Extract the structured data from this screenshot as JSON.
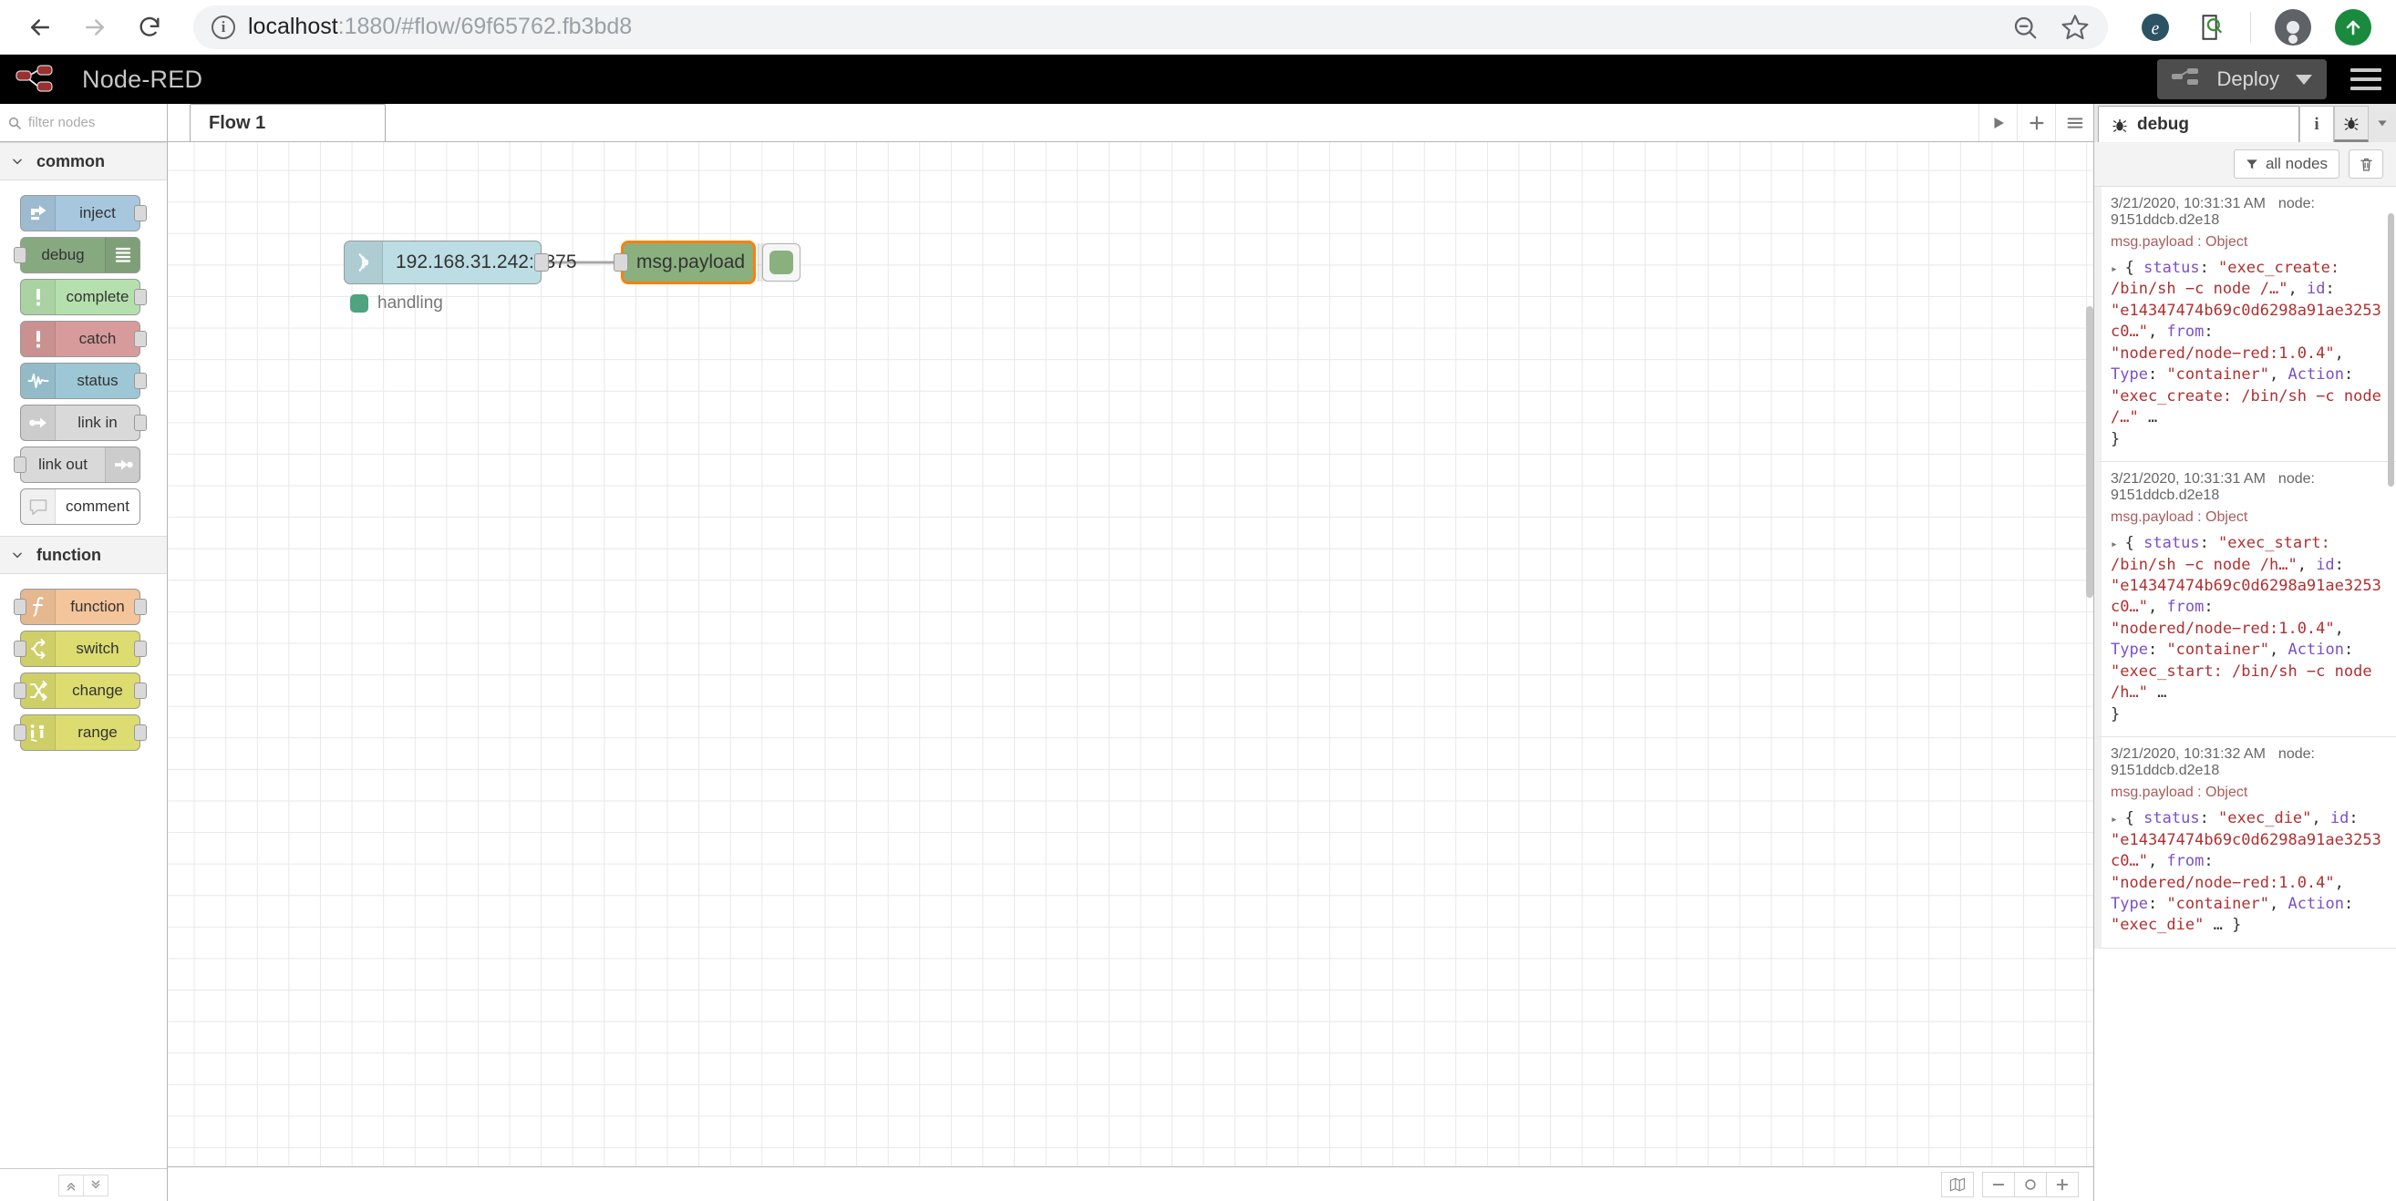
{
  "browser": {
    "back_icon": "back-arrow-icon",
    "forward_icon": "forward-arrow-icon",
    "reload_icon": "reload-icon",
    "info_glyph": "i",
    "url_host": "localhost",
    "url_rest": ":1880/#flow/69f65762.fb3bd8",
    "zoom_out_icon": "zoom-out-icon",
    "bookmark_icon": "star-icon",
    "ext_icons": [
      "extension-e-icon",
      "extension-inspect-icon"
    ],
    "profile_icon": "profile-avatar-icon",
    "update_icon": "update-arrow-icon"
  },
  "header": {
    "title": "Node-RED",
    "deploy_label": "Deploy",
    "menu_icon": "hamburger-menu-icon"
  },
  "palette": {
    "search_placeholder": "filter nodes",
    "categories": [
      {
        "name": "common",
        "nodes": [
          {
            "label": "inject",
            "icon": "inject-arrow-icon",
            "bg": "#a7c7de",
            "icon_side": "left",
            "port_in": false,
            "port_out": true
          },
          {
            "label": "debug",
            "icon": "debug-list-icon",
            "bg": "#87a980",
            "icon_side": "right",
            "port_in": true,
            "port_out": false
          },
          {
            "label": "complete",
            "icon": "exclamation-icon",
            "bg": "#b5e0ad",
            "icon_side": "left",
            "port_in": false,
            "port_out": true
          },
          {
            "label": "catch",
            "icon": "exclamation-icon",
            "bg": "#d79b9b",
            "icon_side": "left",
            "port_in": false,
            "port_out": true
          },
          {
            "label": "status",
            "icon": "waveform-icon",
            "bg": "#9dc7d4",
            "icon_side": "left",
            "port_in": false,
            "port_out": true
          },
          {
            "label": "link in",
            "icon": "link-in-icon",
            "bg": "#d9d9d9",
            "icon_side": "left",
            "port_in": false,
            "port_out": true
          },
          {
            "label": "link out",
            "icon": "link-out-icon",
            "bg": "#d9d9d9",
            "icon_side": "right",
            "port_in": true,
            "port_out": false
          },
          {
            "label": "comment",
            "icon": "comment-bubble-icon",
            "bg": "#ffffff",
            "icon_side": "left",
            "port_in": false,
            "port_out": false
          }
        ]
      },
      {
        "name": "function",
        "nodes": [
          {
            "label": "function",
            "icon": "function-f-icon",
            "bg": "#f4c49a",
            "icon_side": "left",
            "port_in": true,
            "port_out": true
          },
          {
            "label": "switch",
            "icon": "switch-branch-icon",
            "bg": "#dcdc70",
            "icon_side": "left",
            "port_in": true,
            "port_out": true
          },
          {
            "label": "change",
            "icon": "change-swap-icon",
            "bg": "#dcdc70",
            "icon_side": "left",
            "port_in": true,
            "port_out": true
          },
          {
            "label": "range",
            "icon": "range-bars-icon",
            "bg": "#dcdc70",
            "icon_side": "left",
            "port_in": true,
            "port_out": true
          }
        ]
      }
    ],
    "footer_buttons": [
      "collapse-all-icon",
      "expand-all-icon"
    ]
  },
  "flow": {
    "tab_label": "Flow 1",
    "toolbar_buttons": [
      "play-icon",
      "add-tab-icon",
      "list-tabs-icon"
    ],
    "nodes": [
      {
        "label": "192.168.31.242:2375",
        "icon": "docker-events-signal-icon",
        "bg": "#bcdde4",
        "status": "handling",
        "status_color": "#4ea47e"
      },
      {
        "label": "msg.payload",
        "icon": "debug-list-icon",
        "bg": "#8ab07e",
        "selected": true
      }
    ],
    "statusbar_buttons": [
      "map-icon",
      "zoom-out-icon",
      "zoom-reset-icon",
      "zoom-in-icon"
    ]
  },
  "sidebar": {
    "tab_label": "debug",
    "tab_icon": "bug-icon",
    "header_buttons": [
      "info-icon",
      "bug-icon",
      "chevron-down-icon"
    ],
    "filter_label": "all nodes",
    "filter_icon": "funnel-icon",
    "clear_icon": "trash-icon",
    "messages": [
      {
        "timestamp": "3/21/2020, 10:31:31 AM",
        "node": "node: 9151ddcb.d2e18",
        "topic": "msg.payload : Object",
        "parts": [
          {
            "t": "p",
            "v": "{ "
          },
          {
            "t": "k",
            "v": "status"
          },
          {
            "t": "p",
            "v": ": "
          },
          {
            "t": "s",
            "v": "\"exec_create: /bin/sh −c node /…\""
          },
          {
            "t": "p",
            "v": ", "
          },
          {
            "t": "k",
            "v": "id"
          },
          {
            "t": "p",
            "v": ": "
          },
          {
            "t": "s",
            "v": "\"e14347474b69c0d6298a91ae3253c0…\""
          },
          {
            "t": "p",
            "v": ", "
          },
          {
            "t": "k",
            "v": "from"
          },
          {
            "t": "p",
            "v": ": "
          },
          {
            "t": "s",
            "v": "\"nodered/node−red:1.0.4\""
          },
          {
            "t": "p",
            "v": ", "
          },
          {
            "t": "k",
            "v": "Type"
          },
          {
            "t": "p",
            "v": ": "
          },
          {
            "t": "s",
            "v": "\"container\""
          },
          {
            "t": "p",
            "v": ", "
          },
          {
            "t": "k",
            "v": "Action"
          },
          {
            "t": "p",
            "v": ": "
          },
          {
            "t": "s",
            "v": "\"exec_create: /bin/sh −c node /…\""
          },
          {
            "t": "p",
            "v": " … }"
          }
        ]
      },
      {
        "timestamp": "3/21/2020, 10:31:31 AM",
        "node": "node: 9151ddcb.d2e18",
        "topic": "msg.payload : Object",
        "parts": [
          {
            "t": "p",
            "v": "{ "
          },
          {
            "t": "k",
            "v": "status"
          },
          {
            "t": "p",
            "v": ": "
          },
          {
            "t": "s",
            "v": "\"exec_start: /bin/sh −c node /h…\""
          },
          {
            "t": "p",
            "v": ", "
          },
          {
            "t": "k",
            "v": "id"
          },
          {
            "t": "p",
            "v": ": "
          },
          {
            "t": "s",
            "v": "\"e14347474b69c0d6298a91ae3253c0…\""
          },
          {
            "t": "p",
            "v": ", "
          },
          {
            "t": "k",
            "v": "from"
          },
          {
            "t": "p",
            "v": ": "
          },
          {
            "t": "s",
            "v": "\"nodered/node−red:1.0.4\""
          },
          {
            "t": "p",
            "v": ", "
          },
          {
            "t": "k",
            "v": "Type"
          },
          {
            "t": "p",
            "v": ": "
          },
          {
            "t": "s",
            "v": "\"container\""
          },
          {
            "t": "p",
            "v": ", "
          },
          {
            "t": "k",
            "v": "Action"
          },
          {
            "t": "p",
            "v": ": "
          },
          {
            "t": "s",
            "v": "\"exec_start: /bin/sh −c node /h…\""
          },
          {
            "t": "p",
            "v": " … }"
          }
        ]
      },
      {
        "timestamp": "3/21/2020, 10:31:32 AM",
        "node": "node: 9151ddcb.d2e18",
        "topic": "msg.payload : Object",
        "parts": [
          {
            "t": "p",
            "v": "{ "
          },
          {
            "t": "k",
            "v": "status"
          },
          {
            "t": "p",
            "v": ": "
          },
          {
            "t": "s",
            "v": "\"exec_die\""
          },
          {
            "t": "p",
            "v": ", "
          },
          {
            "t": "k",
            "v": "id"
          },
          {
            "t": "p",
            "v": ": "
          },
          {
            "t": "s",
            "v": "\"e14347474b69c0d6298a91ae3253c0…\""
          },
          {
            "t": "p",
            "v": ", "
          },
          {
            "t": "k",
            "v": "from"
          },
          {
            "t": "p",
            "v": ": "
          },
          {
            "t": "s",
            "v": "\"nodered/node−red:1.0.4\""
          },
          {
            "t": "p",
            "v": ", "
          },
          {
            "t": "k",
            "v": "Type"
          },
          {
            "t": "p",
            "v": ": "
          },
          {
            "t": "s",
            "v": "\"container\""
          },
          {
            "t": "p",
            "v": ", "
          },
          {
            "t": "k",
            "v": "Action"
          },
          {
            "t": "p",
            "v": ": "
          },
          {
            "t": "s",
            "v": "\"exec_die\""
          },
          {
            "t": "p",
            "v": " … }"
          }
        ]
      }
    ]
  },
  "colors": {
    "accent_orange": "#ff7f0e",
    "status_green": "#4ea47e",
    "brand_red": "#8f2f2f",
    "json_key": "#7b4fc9",
    "json_string": "#b03030"
  }
}
